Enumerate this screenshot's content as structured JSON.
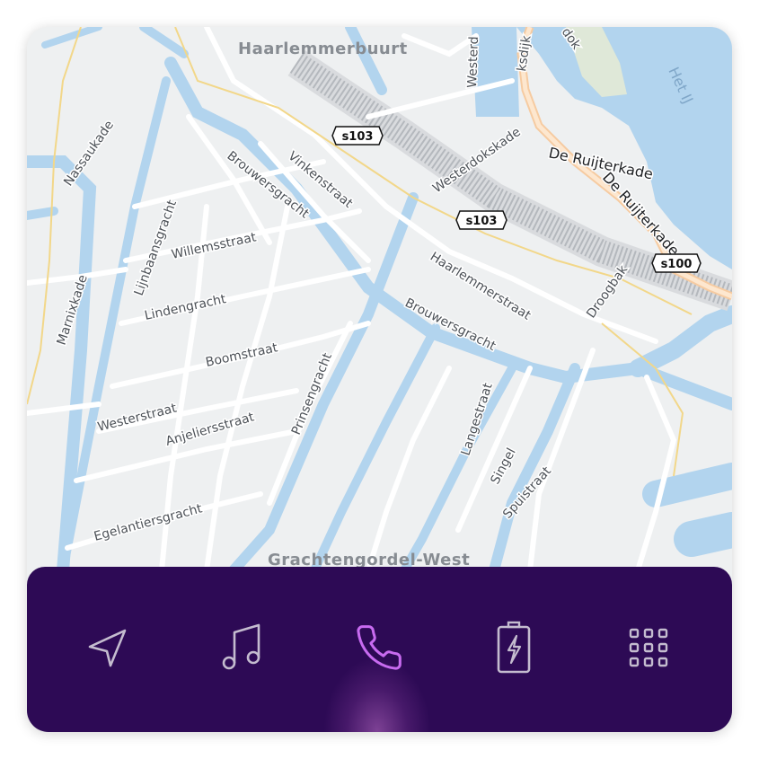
{
  "map": {
    "districts": [
      "Haarlemmerbuurt",
      "Grachtengordel-West"
    ],
    "water_labels": [
      "Het IJ"
    ],
    "streets": {
      "nassaukade": "Nassaukade",
      "marnixkade": "Marnixkade",
      "lijnbaansgracht": "Lijnbaansgracht",
      "brouwersgracht_upper": "Brouwersgracht",
      "brouwersgracht_lower": "Brouwersgracht",
      "vinkenstraat": "Vinkenstraat",
      "westerdokskade": "Westerdokskade",
      "de_ruijterkade": "De Ruijterkade",
      "willemsstraat": "Willemsstraat",
      "lindengracht": "Lindengracht",
      "boomstraat": "Boomstraat",
      "westerstraat": "Westerstraat",
      "anjeliersstraat": "Anjeliersstraat",
      "egelantiersgracht": "Egelantiersgracht",
      "prinsengracht": "Prinsengracht",
      "haarlemmerstraat": "Haarlemmerstraat",
      "langestraat": "Langestraat",
      "singel": "Singel",
      "spuistraat": "Spuistraat",
      "droogbak": "Droogbak",
      "westerdok_partial": "Westerd",
      "dijk_partial": "ksdijk",
      "dok_partial": "dok"
    },
    "route_shields": [
      "s103",
      "s103",
      "s100"
    ]
  },
  "navbar": {
    "items": [
      {
        "name": "navigation",
        "icon": "navigation-arrow-icon",
        "active": false
      },
      {
        "name": "music",
        "icon": "music-note-icon",
        "active": false
      },
      {
        "name": "phone",
        "icon": "phone-icon",
        "active": true
      },
      {
        "name": "battery",
        "icon": "battery-charging-icon",
        "active": false
      },
      {
        "name": "apps",
        "icon": "app-grid-icon",
        "active": false
      }
    ],
    "colors": {
      "background": "#2d0a55",
      "icon": "#c4bccf",
      "active_icon": "#c86bf0"
    }
  }
}
